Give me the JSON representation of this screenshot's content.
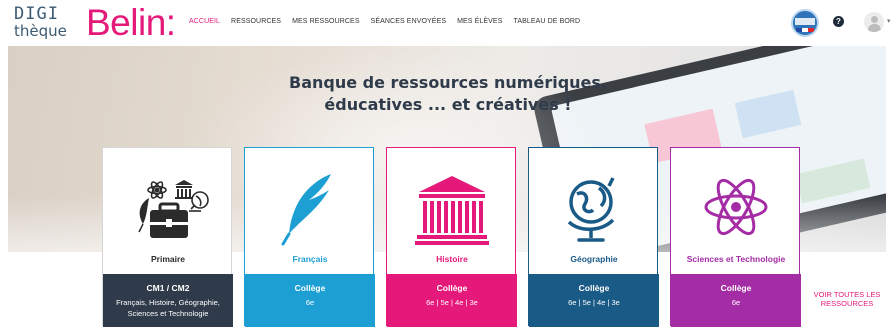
{
  "logo": {
    "line1": "DIGI",
    "line2": "thèque",
    "brand": "Belin:"
  },
  "nav": [
    {
      "label": "ACCUEIL",
      "active": true
    },
    {
      "label": "RESSOURCES"
    },
    {
      "label": "MES RESSOURCES"
    },
    {
      "label": "SÉANCES ENVOYÉES"
    },
    {
      "label": "MES ÉLÈVES"
    },
    {
      "label": "TABLEAU DE BORD"
    }
  ],
  "header_right": {
    "help_label": "?",
    "caret": "▾"
  },
  "hero": {
    "title_line1": "Banque de ressources numériques,",
    "title_line2": "éducatives ... et créatives !"
  },
  "cards": [
    {
      "title": "Primaire",
      "level": "CM1 / CM2",
      "grades": "Français, Histoire, Géographie, Sciences et Technologie",
      "icon": "school-items-icon",
      "color": "#2f3b4a"
    },
    {
      "title": "Français",
      "level": "Collège",
      "grades": "6e",
      "icon": "quill-icon",
      "color": "#1e9fd4"
    },
    {
      "title": "Histoire",
      "level": "Collège",
      "grades": "6e | 5e | 4e | 3e",
      "icon": "temple-icon",
      "color": "#e4197a"
    },
    {
      "title": "Géographie",
      "level": "Collège",
      "grades": "6e | 5e | 4e | 3e",
      "icon": "globe-icon",
      "color": "#1a5a86"
    },
    {
      "title": "Sciences et Technologie",
      "level": "Collège",
      "grades": "6e",
      "icon": "atom-icon",
      "color": "#a42ca5"
    }
  ],
  "see_all": "VOIR TOUTES LES RESSOURCES",
  "colors": {
    "brand_pink": "#e4197a",
    "logo_blue": "#3d5a73"
  }
}
